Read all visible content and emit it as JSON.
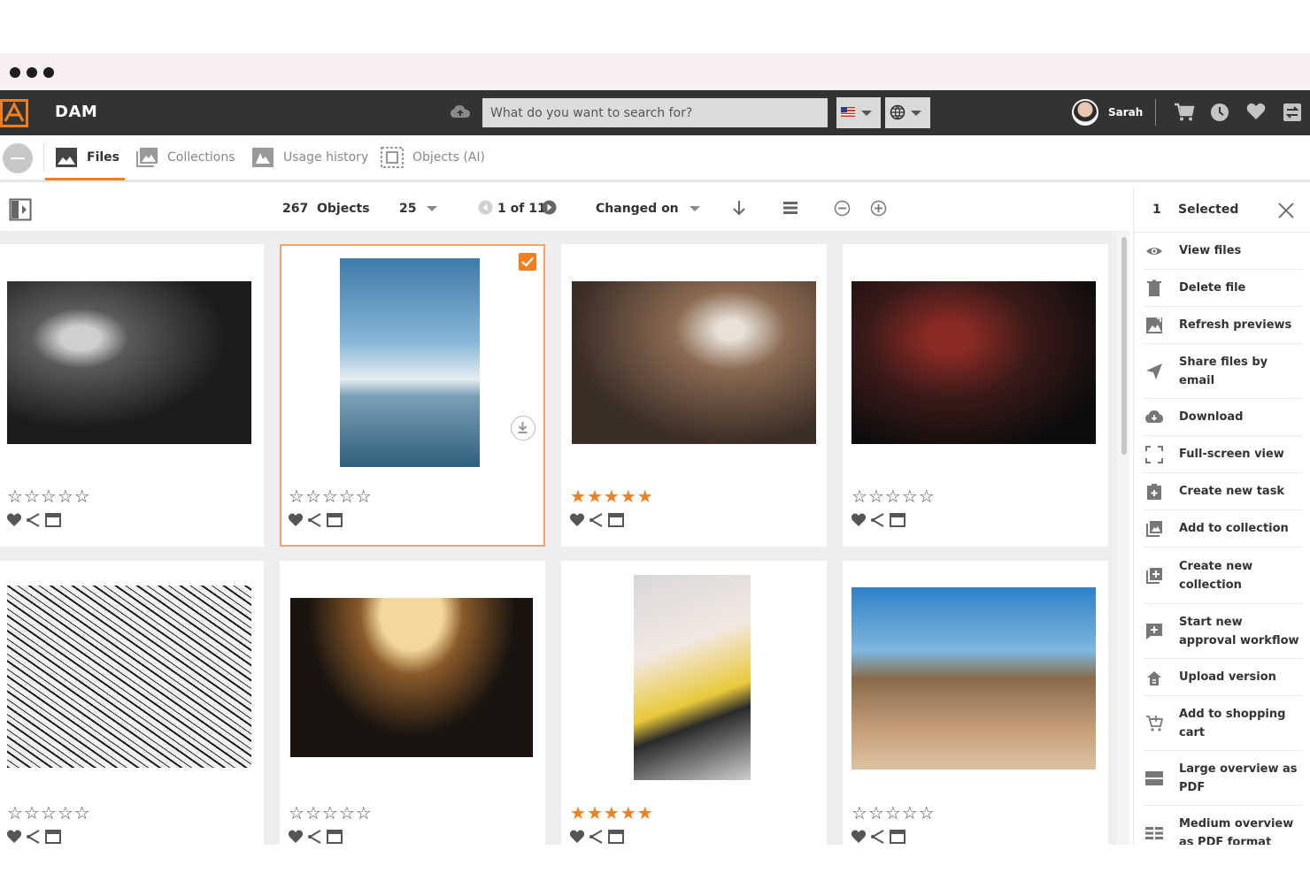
{
  "header": {
    "app_title": "DAM",
    "search_placeholder": "What do you want to search for?",
    "user_name": "Sarah"
  },
  "tabs": [
    {
      "label": "Files",
      "active": true
    },
    {
      "label": "Collections",
      "active": false
    },
    {
      "label": "Usage history",
      "active": false
    },
    {
      "label": "Objects (AI)",
      "active": false
    }
  ],
  "toolbar": {
    "object_count": "267",
    "objects_label": "Objects",
    "page_size": "25",
    "pagination": "1 of 11",
    "sort_label": "Changed on"
  },
  "cards": [
    {
      "rating": 0,
      "selected": false
    },
    {
      "rating": 0,
      "selected": true
    },
    {
      "rating": 5,
      "selected": false
    },
    {
      "rating": 0,
      "selected": false
    },
    {
      "rating": 0,
      "selected": false
    },
    {
      "rating": 0,
      "selected": false
    },
    {
      "rating": 5,
      "selected": false
    },
    {
      "rating": 0,
      "selected": false
    }
  ],
  "panel": {
    "count": "1",
    "selected_label": "Selected",
    "items": [
      {
        "label": "View files",
        "icon": "eye-icon"
      },
      {
        "label": "Delete file",
        "icon": "trash-icon"
      },
      {
        "label": "Refresh previews",
        "icon": "refresh-preview-icon"
      },
      {
        "label": "Share files by email",
        "icon": "send-icon"
      },
      {
        "label": "Download",
        "icon": "cloud-download-icon"
      },
      {
        "label": "Full-screen view",
        "icon": "fullscreen-icon"
      },
      {
        "label": "Create new task",
        "icon": "task-icon"
      },
      {
        "label": "Add to collection",
        "icon": "collection-icon"
      },
      {
        "label": "Create new collection",
        "icon": "new-collection-icon"
      },
      {
        "label": "Start new approval workflow",
        "icon": "approval-icon"
      },
      {
        "label": "Upload version",
        "icon": "upload-version-icon"
      },
      {
        "label": "Add to shopping cart",
        "icon": "cart-add-icon"
      },
      {
        "label": "Large overview as PDF",
        "icon": "large-pdf-icon"
      },
      {
        "label": "Medium overview as PDF format",
        "icon": "medium-pdf-icon"
      }
    ]
  },
  "colors": {
    "accent": "#f07f1f",
    "header_bg": "#333333"
  }
}
